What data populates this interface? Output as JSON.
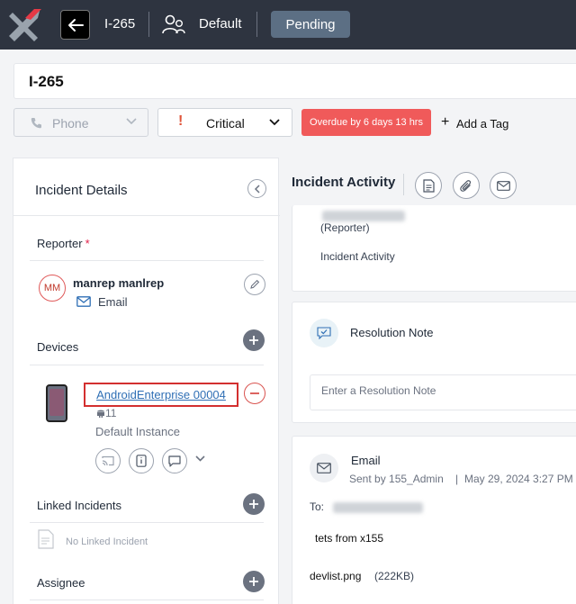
{
  "topbar": {
    "incident_id": "I-265",
    "workspace": "Default",
    "status": "Pending"
  },
  "header": {
    "title": "I-265"
  },
  "controls": {
    "source": "Phone",
    "priority": "Critical",
    "overdue": "Overdue by 6 days 13 hrs",
    "add_tag": "Add a Tag"
  },
  "details": {
    "title": "Incident Details",
    "reporter_label": "Reporter",
    "required_mark": "*",
    "reporter": {
      "initials": "MM",
      "name": "manrep manlrep",
      "contact": "Email"
    },
    "devices_label": "Devices",
    "device": {
      "name": "AndroidEnterprise 00004",
      "os_version": "11",
      "instance": "Default Instance"
    },
    "linked_label": "Linked Incidents",
    "linked_empty": "No Linked Incident",
    "assignee_label": "Assignee"
  },
  "activity": {
    "title": "Incident Activity",
    "entry1": {
      "role": "(Reporter)",
      "text": "Incident Activity"
    },
    "resolution": {
      "title": "Resolution Note",
      "placeholder": "Enter a Resolution Note"
    },
    "email": {
      "title": "Email",
      "sent_by": "Sent by 155_Admin",
      "sep": "|",
      "date": "May 29, 2024 3:27 PM",
      "to_label": "To:",
      "body": "tets from x155",
      "attachment_name": "devlist.png",
      "attachment_size": "(222KB)"
    }
  },
  "colors": {
    "topbar": "#2e3440",
    "status_pill": "#5c6f84",
    "overdue": "#f05a5a",
    "link": "#2f6fb5",
    "highlight_box": "#d32f2f"
  }
}
